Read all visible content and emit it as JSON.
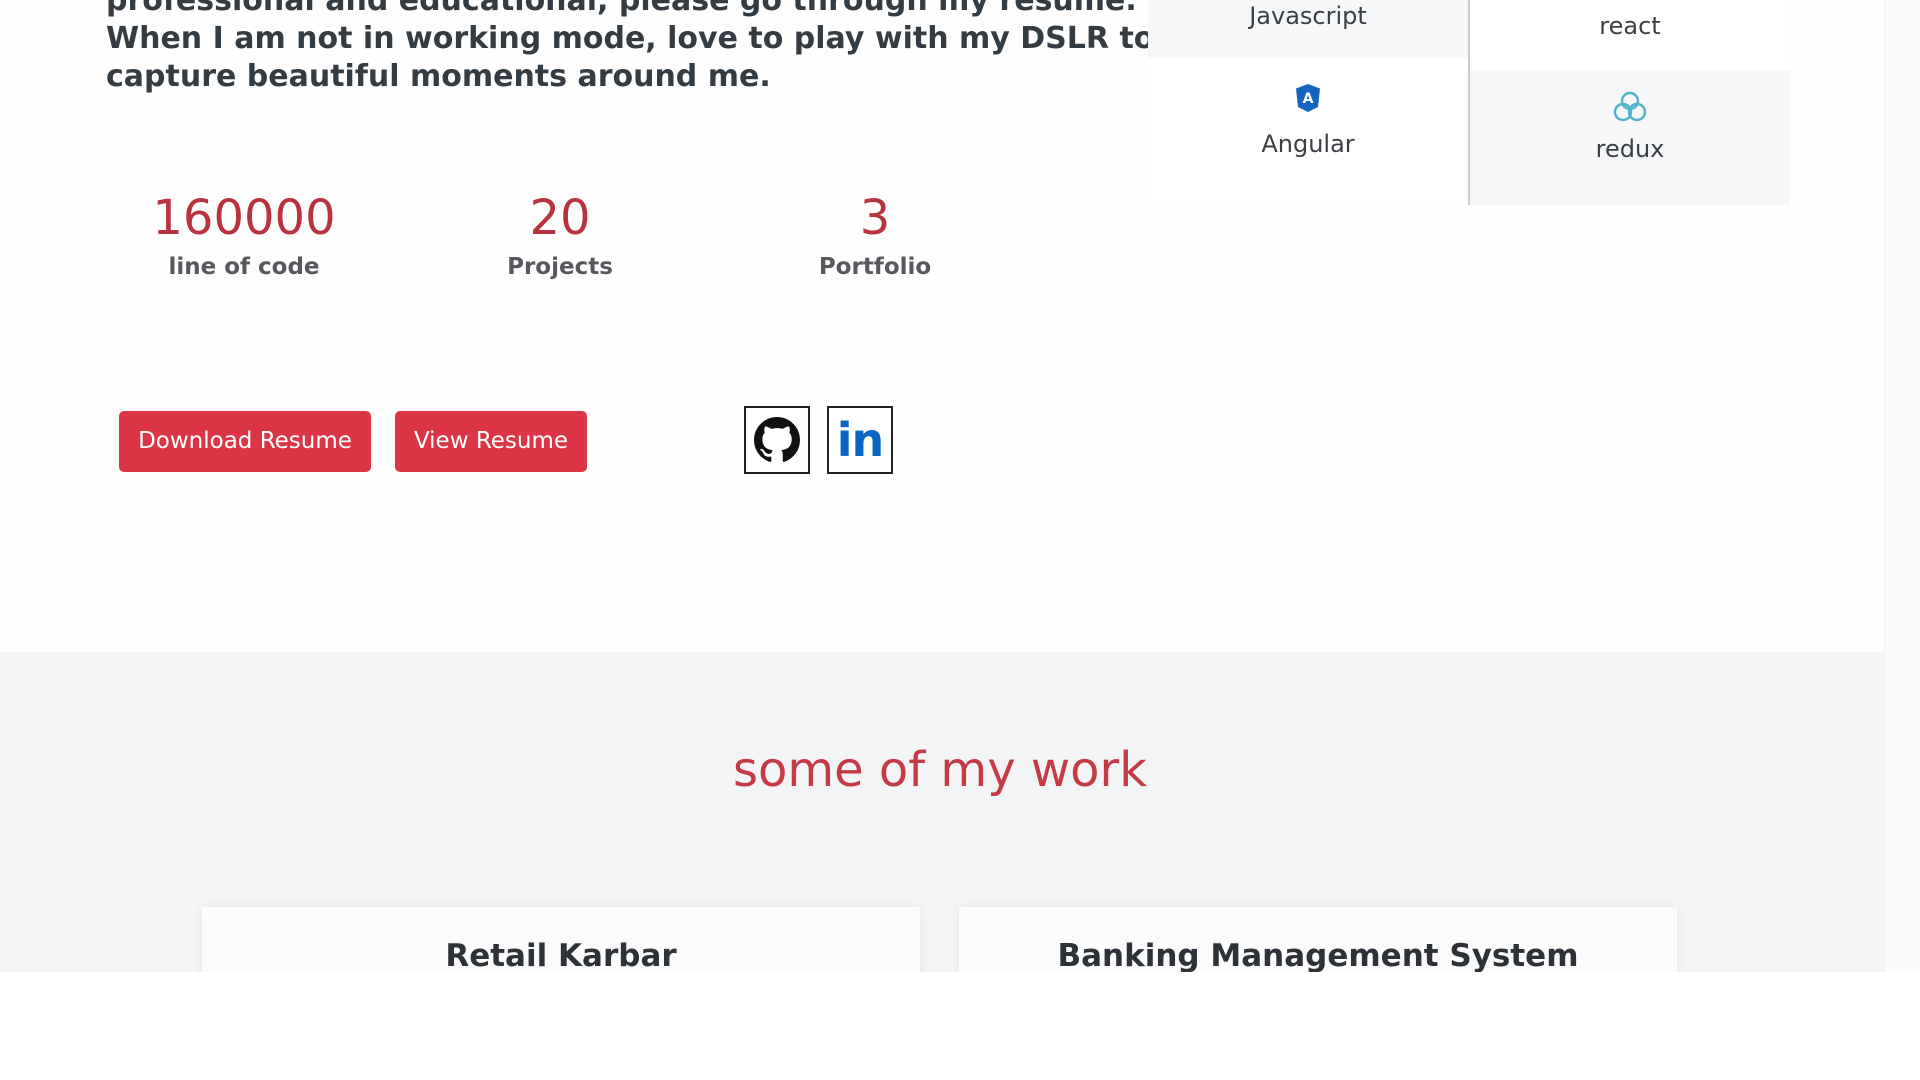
{
  "about": {
    "bio_line1": "professional and educational, please go through my resume.",
    "bio_line2": "When I am not in working mode, love to play with my DSLR to",
    "bio_line3": "capture beautiful moments around me."
  },
  "stats": [
    {
      "value": "160000",
      "label": "line of code"
    },
    {
      "value": "20",
      "label": "Projects"
    },
    {
      "value": "3",
      "label": "Portfolio"
    }
  ],
  "actions": {
    "download_resume": "Download Resume",
    "view_resume": "View Resume"
  },
  "social": {
    "github_icon": "github-icon",
    "linkedin_icon": "linkedin-icon",
    "linkedin_text": "in"
  },
  "skills": [
    {
      "label": "Javascript",
      "icon": "javascript-icon"
    },
    {
      "label": "react",
      "icon": "react-icon"
    },
    {
      "label": "Angular",
      "icon": "angular-icon"
    },
    {
      "label": "redux",
      "icon": "redux-icon"
    }
  ],
  "work": {
    "title": "some of my work",
    "projects": [
      {
        "title": "Retail Karbar"
      },
      {
        "title": "Banking Management System"
      }
    ]
  },
  "colors": {
    "accent": "#dc3545",
    "stat_value": "#b8333f",
    "work_title": "#c43a45",
    "angular": "#1565c0",
    "redux": "#4fb3c9",
    "linkedin": "#0a66c2"
  }
}
